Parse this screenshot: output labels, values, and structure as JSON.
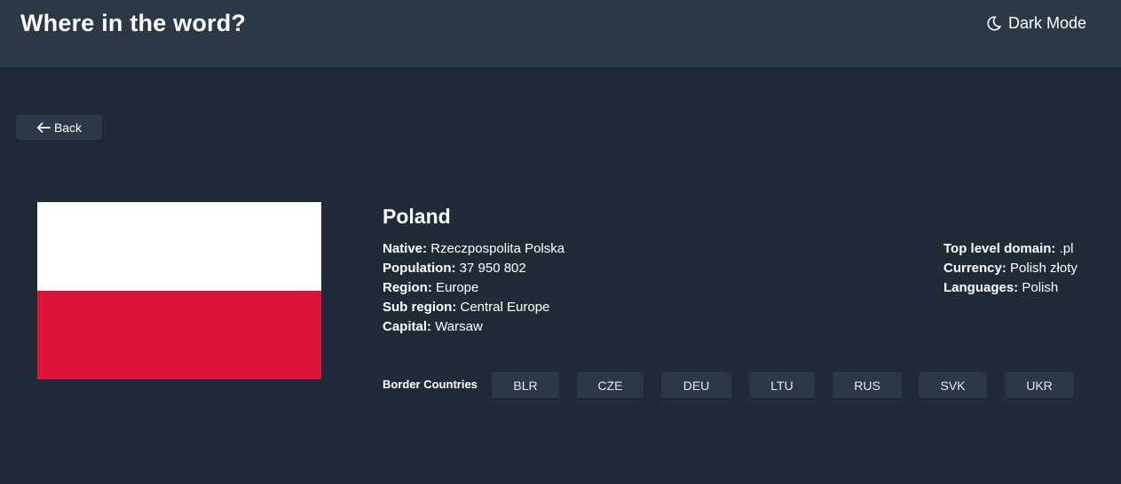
{
  "header": {
    "title": "Where in the word?",
    "theme_toggle_label": "Dark Mode",
    "theme_icon": "moon-icon"
  },
  "back_button": {
    "label": "Back",
    "icon": "arrow-left-icon"
  },
  "country": {
    "name": "Poland",
    "flag_colors": [
      "#ffffff",
      "#dc143c"
    ],
    "details_left": [
      {
        "label": "Native:",
        "value": "Rzeczpospolita Polska"
      },
      {
        "label": "Population:",
        "value": "37 950 802"
      },
      {
        "label": "Region:",
        "value": "Europe"
      },
      {
        "label": "Sub region:",
        "value": "Central Europe"
      },
      {
        "label": "Capital:",
        "value": "Warsaw"
      }
    ],
    "details_right": [
      {
        "label": "Top level domain:",
        "value": ".pl"
      },
      {
        "label": "Currency:",
        "value": "Polish złoty"
      },
      {
        "label": "Languages:",
        "value": "Polish"
      }
    ],
    "border_label": "Border Countries",
    "borders": [
      "BLR",
      "CZE",
      "DEU",
      "LTU",
      "RUS",
      "SVK",
      "UKR"
    ]
  },
  "colors": {
    "background": "#202b38",
    "surface": "#2b3845",
    "text": "#ffffff"
  }
}
